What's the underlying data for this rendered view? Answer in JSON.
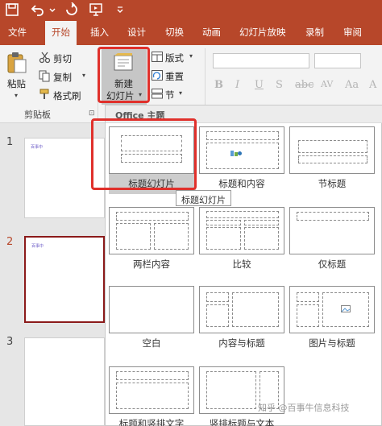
{
  "tabs": [
    "文件",
    "开始",
    "插入",
    "设计",
    "切换",
    "动画",
    "幻灯片放映",
    "录制",
    "审阅"
  ],
  "ribbon": {
    "paste": "粘贴",
    "cut": "剪切",
    "copy": "复制",
    "format_painter": "格式刷",
    "clipboard_group": "剪贴板",
    "new_slide_line1": "新建",
    "new_slide_line2": "幻灯片",
    "layout": "版式",
    "reset": "重置",
    "section": "节"
  },
  "thumbnails": {
    "numbers": [
      "1",
      "2",
      "3"
    ],
    "placeholder_text": "百事中"
  },
  "gallery": {
    "header": "Office 主题",
    "layouts": [
      "标题幻灯片",
      "标题和内容",
      "节标题",
      "两栏内容",
      "比较",
      "仅标题",
      "空白",
      "内容与标题",
      "图片与标题",
      "标题和竖排文字",
      "竖排标题与文本"
    ],
    "tooltip": "标题幻灯片"
  },
  "watermark": "知乎 @百事牛信息科技",
  "colors": {
    "brand": "#b7472a",
    "highlight": "#e0302b"
  }
}
